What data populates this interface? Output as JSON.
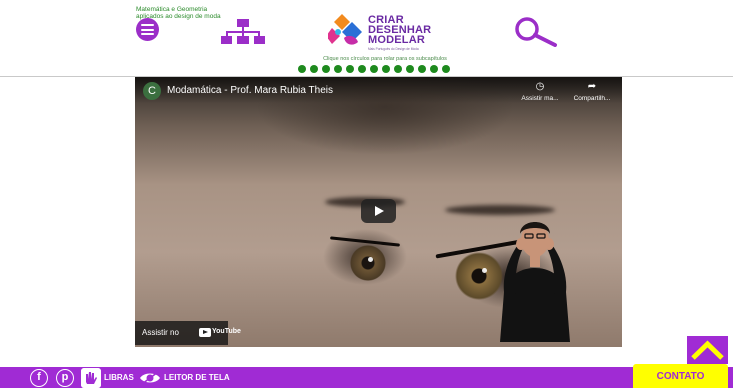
{
  "header": {
    "subtitle_line1": "Matemática e Geometria",
    "subtitle_line2": "aplicados ao design de moda",
    "menu_icon": "hamburger-menu-icon",
    "sitemap_icon": "sitemap-icon",
    "search_icon": "search-icon",
    "logo": {
      "line1": "CRIAR",
      "line2": "DESENHAR",
      "line3": "MODELAR",
      "tagline": "Mais Português do Design de Moda"
    },
    "hint": "Clique nos círculos para rolar para os subcapítulos",
    "dots_count": 13
  },
  "video": {
    "channel_initial": "C",
    "title": "Modamática - Prof. Mara Rubia Theis",
    "watch_later_label": "Assistir ma...",
    "share_label": "Compartilh...",
    "watch_on": "Assistir no",
    "youtube": "YouTube"
  },
  "footer": {
    "facebook": "f",
    "pinterest": "p",
    "libras": "LIBRAS",
    "screen_reader": "LEITOR DE TELA",
    "contact": "CONTATO"
  },
  "colors": {
    "primary_purple": "#a02bd4",
    "green": "#1e8a1e",
    "yellow": "#ffff00"
  }
}
